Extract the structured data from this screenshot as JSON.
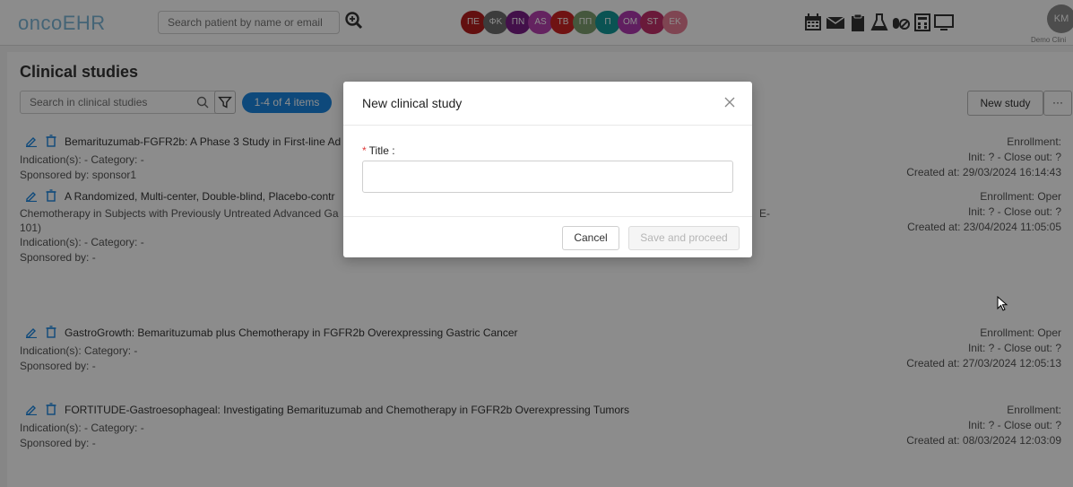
{
  "header": {
    "logo": "oncoEHR",
    "search_placeholder": "Search patient by name or email",
    "icons": [
      "calendar-icon",
      "mail-icon",
      "clipboard-icon",
      "lab-flask-icon",
      "pills-icon",
      "calculator-icon",
      "monitor-icon"
    ],
    "badges": [
      {
        "label": "ΠΕ",
        "color": "#b51e1e"
      },
      {
        "label": "ΦΚ",
        "color": "#6e6e6e"
      },
      {
        "label": "ΠΝ",
        "color": "#7a1e88"
      },
      {
        "label": "AS",
        "color": "#b640b0"
      },
      {
        "label": "TB",
        "color": "#cc2424"
      },
      {
        "label": "ΠΠ",
        "color": "#7e9f70"
      },
      {
        "label": "Π",
        "color": "#139797"
      },
      {
        "label": "OM",
        "color": "#b03ab0"
      },
      {
        "label": "ST",
        "color": "#c2306a"
      },
      {
        "label": "EK",
        "color": "#e87f96"
      }
    ],
    "avatar_initials": "KM",
    "clinic_name": "Demo Clini"
  },
  "page": {
    "title": "Clinical studies",
    "search_placeholder": "Search in clinical studies",
    "count_label": "1-4 of 4 items",
    "new_study_label": "New study",
    "more_label": "···"
  },
  "studies": [
    {
      "title_line1": "Bemarituzumab-FGFR2b: A Phase 3 Study in First-line Ad",
      "title_line2": "",
      "title_line3": "",
      "indication": "Indication(s): -   Category: -",
      "sponsor": "Sponsored by: sponsor1",
      "enrollment": "Enrollment:",
      "init": "Init: ? - Close out: ?",
      "created": "Created at: 29/03/2024 16:14:43"
    },
    {
      "title_line1": "A Randomized, Multi-center, Double-blind, Placebo-contr",
      "title_line2": "Chemotherapy in Subjects with Previously Untreated Advanced Ga",
      "title_line2_tail": "E-",
      "title_line3": "101)",
      "indication": "Indication(s): -   Category: -",
      "sponsor": "Sponsored by: -",
      "enrollment": "Enrollment: Oper",
      "init": "Init: ? - Close out: ?",
      "created": "Created at: 23/04/2024 11:05:05"
    },
    {
      "title_line1": "GastroGrowth: Bemarituzumab plus Chemotherapy in FGFR2b Overexpressing Gastric Cancer",
      "title_line2": "",
      "title_line3": "",
      "indication": "Indication(s):   Category: -",
      "sponsor": "Sponsored by: -",
      "enrollment": "Enrollment: Oper",
      "init": "Init: ? - Close out: ?",
      "created": "Created at: 27/03/2024 12:05:13"
    },
    {
      "title_line1": "FORTITUDE-Gastroesophageal: Investigating Bemarituzumab and Chemotherapy in FGFR2b Overexpressing Tumors",
      "title_line2": "",
      "title_line3": "",
      "indication": "Indication(s): -   Category: -",
      "sponsor": "Sponsored by: -",
      "enrollment": "Enrollment:",
      "init": "Init: ? - Close out: ?",
      "created": "Created at: 08/03/2024 12:03:09"
    }
  ],
  "modal": {
    "title": "New clinical study",
    "required_mark": "*",
    "field_label": "Title :",
    "title_value": "",
    "cancel_label": "Cancel",
    "save_label": "Save and proceed"
  },
  "colors": {
    "accent": "#1b86e0",
    "logo": "#7cb7d8",
    "required": "#e03a3a"
  }
}
